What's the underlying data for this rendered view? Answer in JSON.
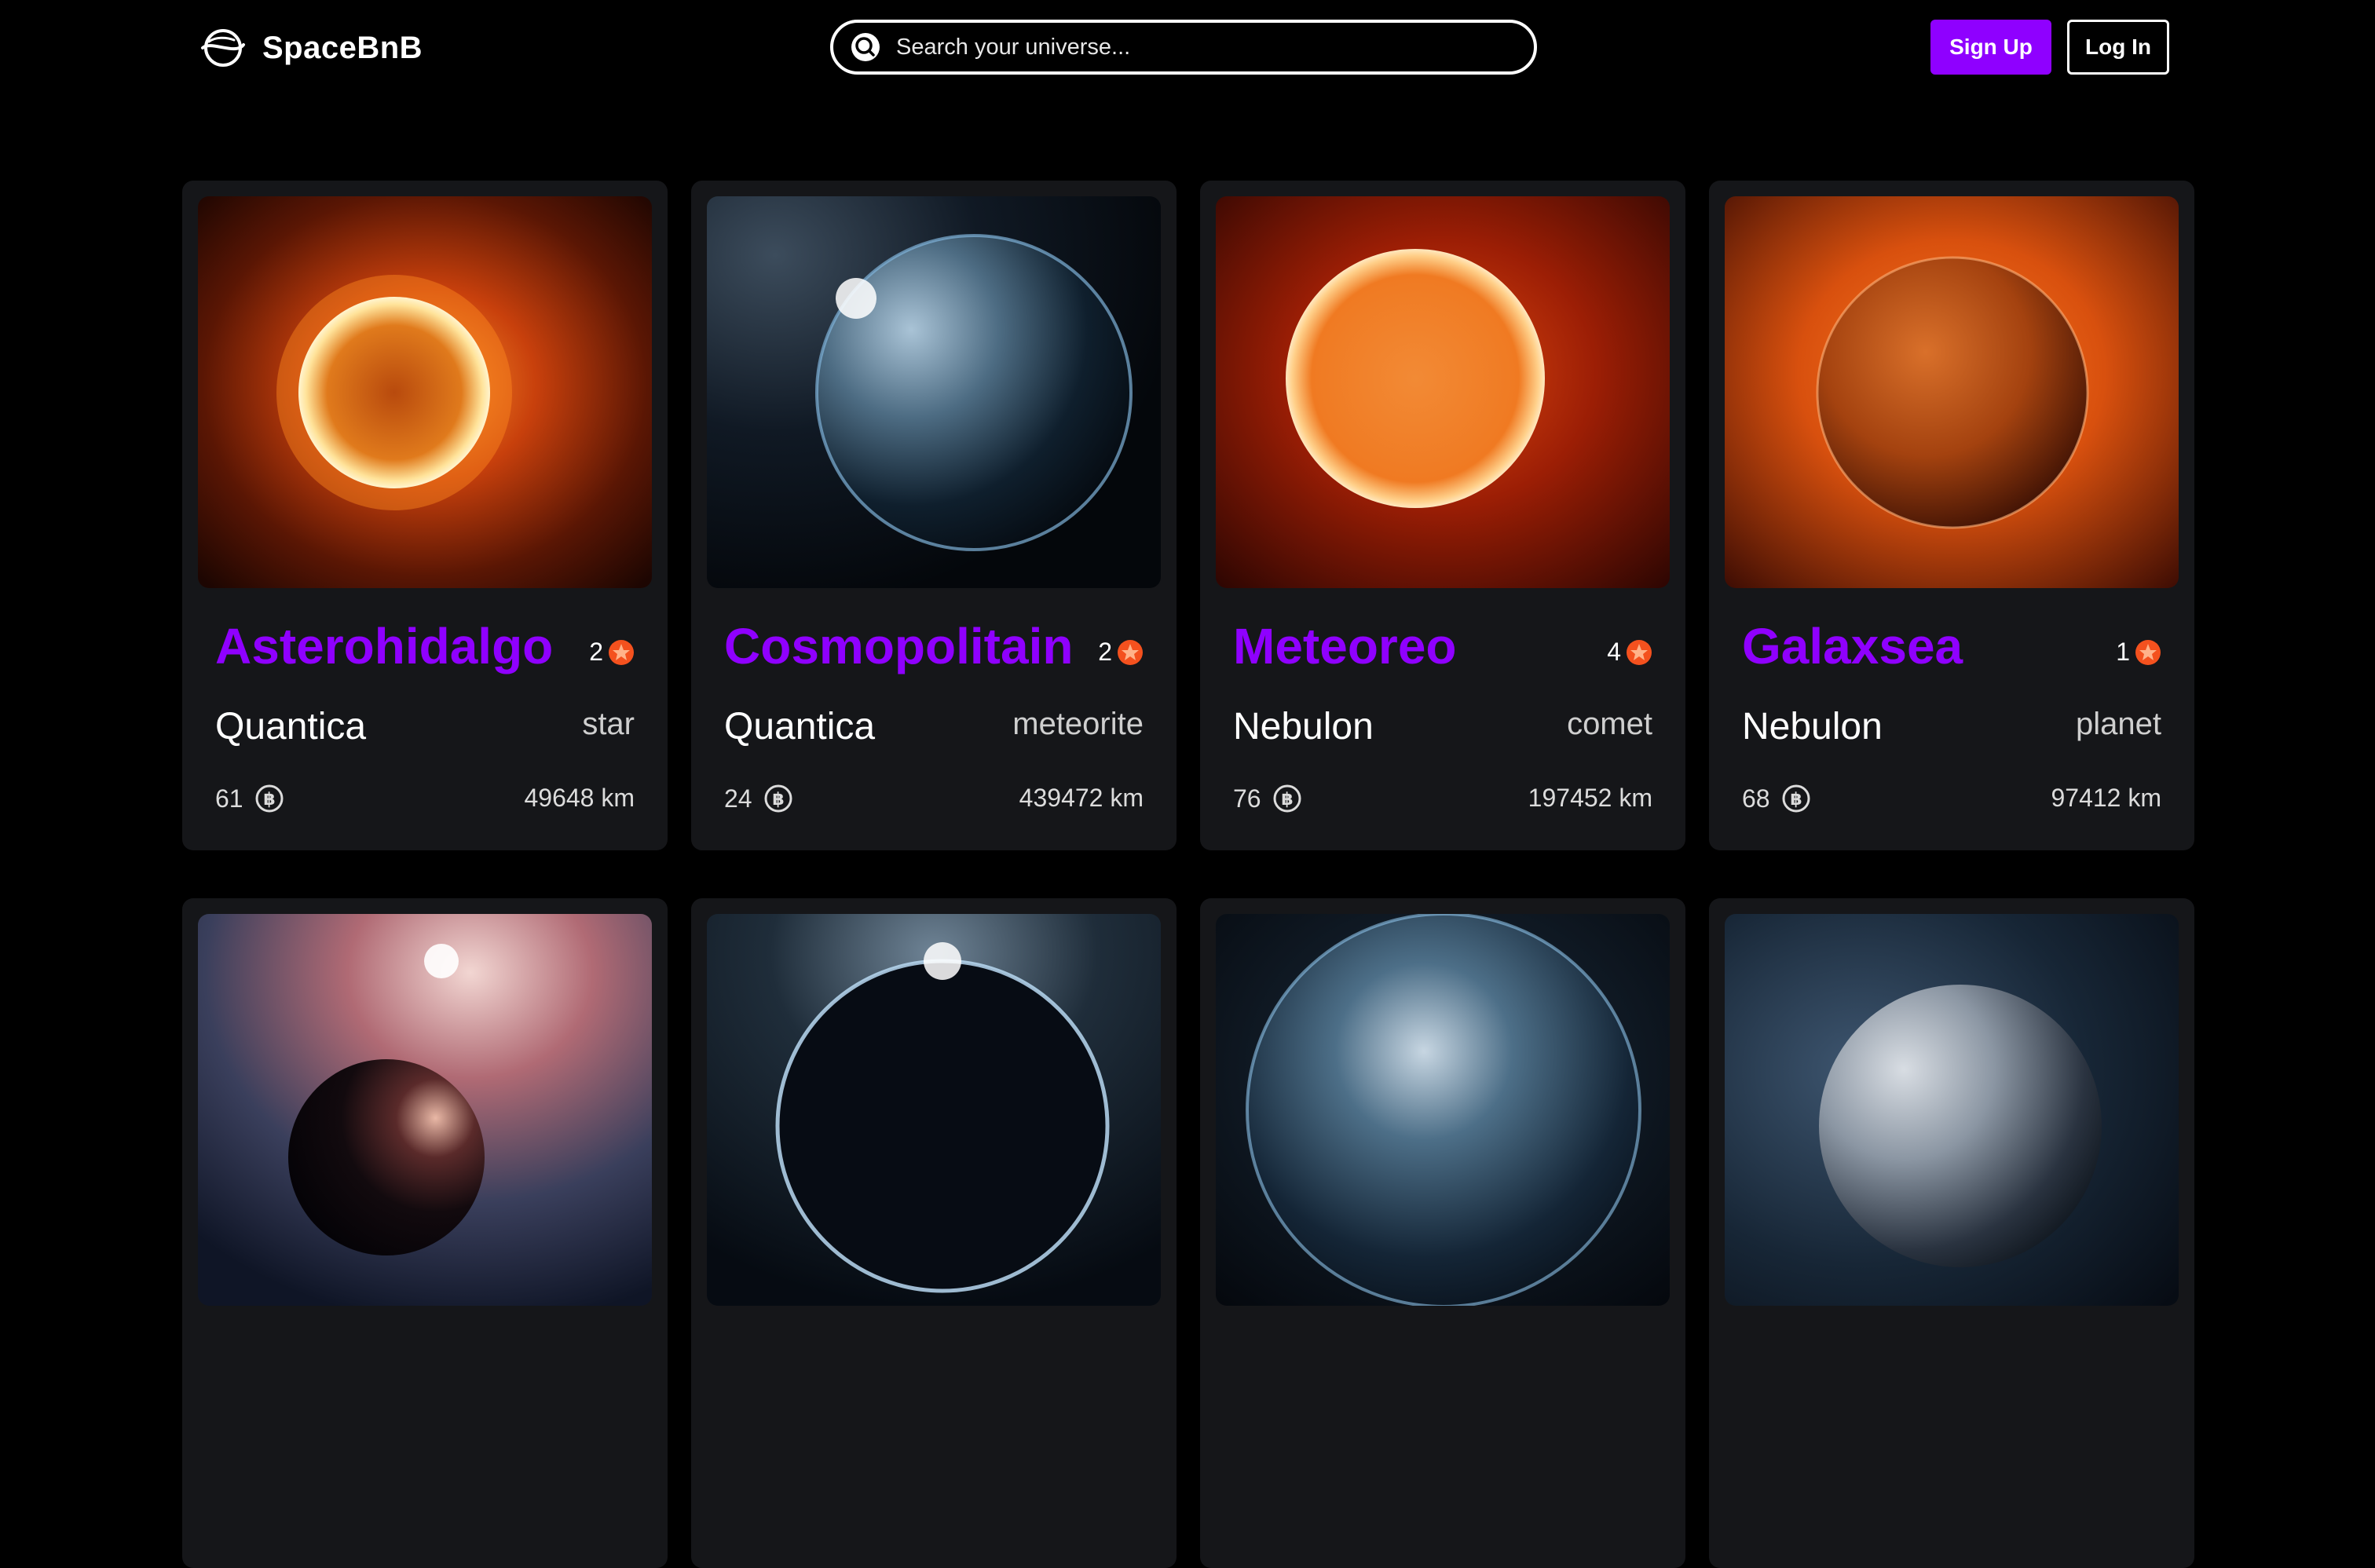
{
  "header": {
    "brand": "SpaceBnB",
    "search_placeholder": "Search your universe...",
    "signup_label": "Sign Up",
    "login_label": "Log In"
  },
  "colors": {
    "accent": "#8f00ff",
    "card_bg": "#151619",
    "page_bg": "#000000",
    "star_badge": "#f4511e"
  },
  "icons": {
    "logo": "planet-logo-icon",
    "search": "search-icon",
    "rating": "star-badge-icon",
    "currency": "bitcoin-coin-icon"
  },
  "listings": [
    {
      "name": "Asterohidalgo",
      "rating": "2",
      "galaxy": "Quantica",
      "type": "star",
      "price": "61",
      "distance": "49648 km",
      "image": "sun-orange"
    },
    {
      "name": "Cosmopolitain",
      "rating": "2",
      "galaxy": "Quantica",
      "type": "meteorite",
      "price": "24",
      "distance": "439472 km",
      "image": "earth-blue"
    },
    {
      "name": "Meteoreo",
      "rating": "4",
      "galaxy": "Nebulon",
      "type": "comet",
      "price": "76",
      "distance": "197452 km",
      "image": "sun-red"
    },
    {
      "name": "Galaxsea",
      "rating": "1",
      "galaxy": "Nebulon",
      "type": "planet",
      "price": "68",
      "distance": "97412 km",
      "image": "mars-orange"
    },
    {
      "image": "dark-planet-nebula"
    },
    {
      "image": "dark-planet-rim"
    },
    {
      "image": "earth-clouds"
    },
    {
      "image": "moon-grey"
    }
  ]
}
